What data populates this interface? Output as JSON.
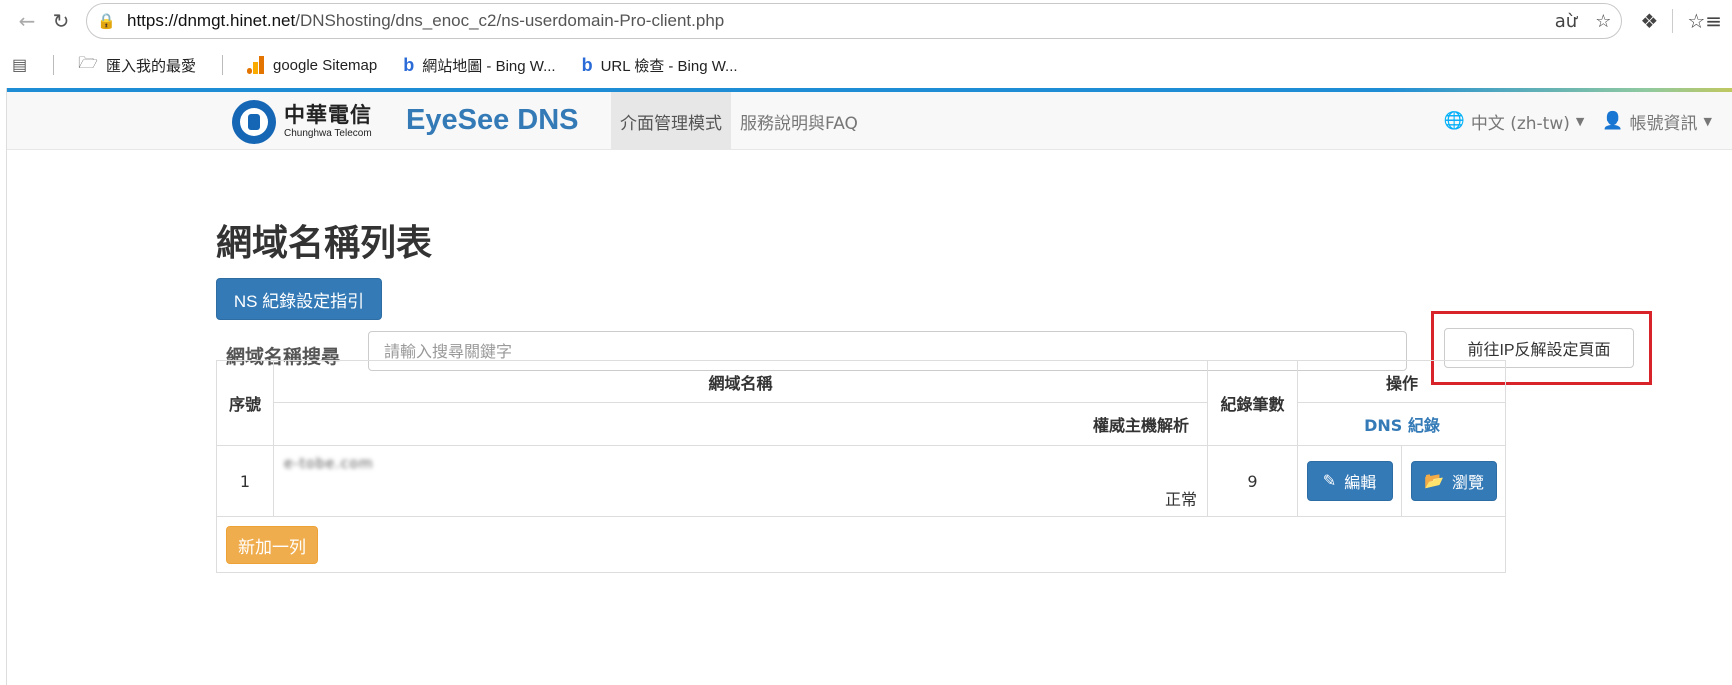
{
  "browser": {
    "url_host": "https://dnmgt.hinet.net",
    "url_path": "/DNShosting/dns_enoc_c2/ns-userdomain-Pro-client.php",
    "bookmarks": [
      {
        "label": "匯入我的最愛",
        "icon": "folder-import-icon"
      },
      {
        "label": "google Sitemap",
        "icon": "google-analytics-icon"
      },
      {
        "label": "網站地圖 - Bing W...",
        "icon": "bing-icon"
      },
      {
        "label": "URL 檢查 - Bing W...",
        "icon": "bing-icon"
      }
    ]
  },
  "navbar": {
    "logo_zh": "中華電信",
    "logo_en": "Chunghwa Telecom",
    "brand": "EyeSee DNS",
    "links": [
      "介面管理模式",
      "服務說明與FAQ"
    ],
    "language": "中文 (zh-tw)",
    "account": "帳號資訊"
  },
  "main": {
    "title": "網域名稱列表",
    "ns_button": "NS 紀錄設定指引",
    "search_label": "網域名稱搜尋",
    "search_placeholder": "請輸入搜尋關鍵字",
    "reverse_ip_button": "前往IP反解設定頁面",
    "add_row_button": "新加一列"
  },
  "table": {
    "headers": {
      "index": "序號",
      "domain": "網域名稱",
      "auth_dns": "權威主機解析",
      "records": "紀錄筆數",
      "actions": "操作",
      "dns_records": "DNS 紀錄"
    },
    "rows": [
      {
        "index": "1",
        "domain": "e-tobe.com",
        "status": "正常",
        "records": "9",
        "edit": "編輯",
        "browse": "瀏覽"
      }
    ]
  },
  "colors": {
    "primary": "#337ab7",
    "warning": "#f0ad4e",
    "highlight": "#d9232a"
  }
}
